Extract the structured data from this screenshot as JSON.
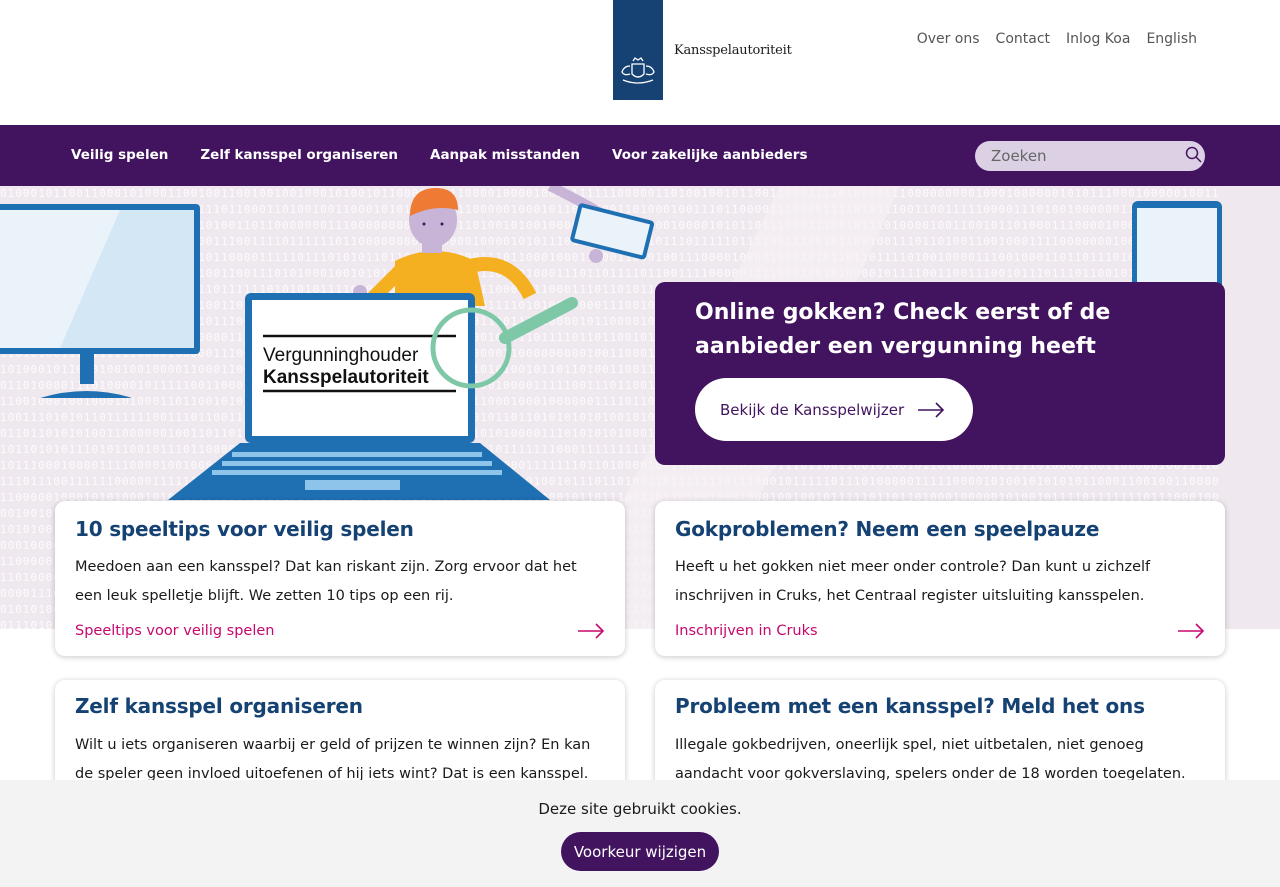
{
  "header": {
    "logo_text": "Kansspelautoriteit",
    "top_links": [
      "Over ons",
      "Contact",
      "Inlog Koa",
      "English"
    ]
  },
  "nav": {
    "items": [
      "Veilig spelen",
      "Zelf kansspel organiseren",
      "Aanpak misstanden",
      "Voor zakelijke aanbieders"
    ],
    "search_placeholder": "Zoeken"
  },
  "hero": {
    "illustration_text_line1": "Vergunninghouder",
    "illustration_text_line2": "Kansspelautoriteit",
    "promo_title": "Online gokken? Check eerst of de aanbieder een vergunning heeft",
    "promo_button": "Bekijk de Kansspelwijzer"
  },
  "cards": [
    {
      "title": "10 speeltips voor veilig spelen",
      "text": "Meedoen aan een kansspel?  Dat kan riskant zijn. Zorg ervoor dat het een leuk spelletje blijft. We zetten 10 tips op een rij.",
      "link": "Speeltips voor veilig spelen"
    },
    {
      "title": "Gokproblemen? Neem een speelpauze",
      "text": "Heeft u het gokken niet meer onder controle? Dan kunt u zichzelf inschrijven in Cruks, het Centraal register uitsluiting kansspelen.",
      "link": "Inschrijven in Cruks"
    },
    {
      "title": "Zelf kansspel organiseren",
      "text": "Wilt u iets organiseren waarbij er geld of prijzen te winnen zijn? En kan de speler geen invloed uitoefenen of hij iets wint? Dat is een kansspel."
    },
    {
      "title": "Probleem met een kansspel? Meld het ons",
      "text": "Illegale gokbedrijven, oneerlijk spel, niet uitbetalen, niet genoeg aandacht voor gokverslaving,  spelers onder de 18 worden toegelaten."
    }
  ],
  "cookie": {
    "text": "Deze site gebruikt cookies.",
    "button": "Voorkeur wijzigen"
  },
  "colors": {
    "brand_purple": "#42145f",
    "heading_blue": "#154273",
    "link_magenta": "#c6076d"
  }
}
